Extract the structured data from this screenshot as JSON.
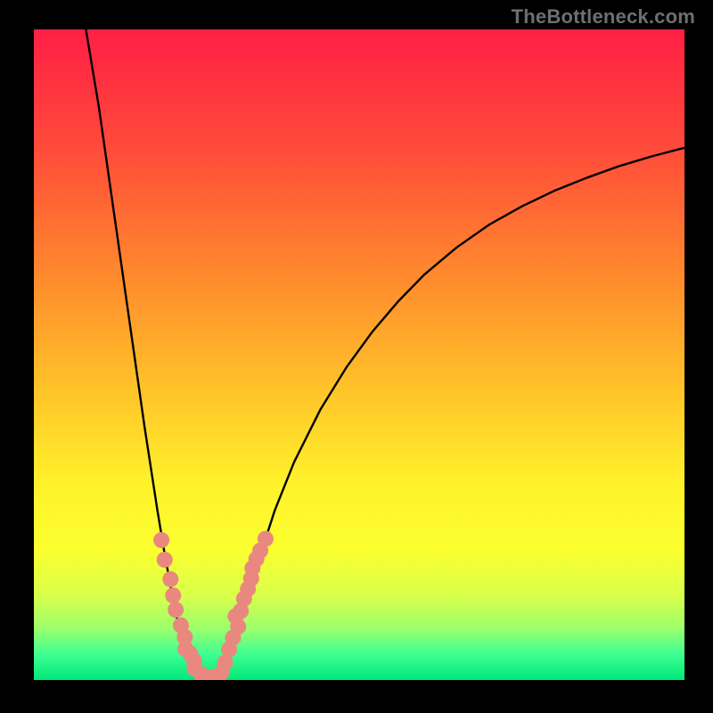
{
  "watermark": "TheBottleneck.com",
  "chart_data": {
    "type": "line",
    "title": "",
    "xlabel": "",
    "ylabel": "",
    "xlim": [
      0,
      100
    ],
    "ylim": [
      0,
      100
    ],
    "grid": false,
    "legend": false,
    "gradient_stops": [
      {
        "offset": 0.0,
        "color": "#ff1f45"
      },
      {
        "offset": 0.18,
        "color": "#ff4a3a"
      },
      {
        "offset": 0.38,
        "color": "#ff8a2d"
      },
      {
        "offset": 0.55,
        "color": "#ffc229"
      },
      {
        "offset": 0.7,
        "color": "#fff22a"
      },
      {
        "offset": 0.8,
        "color": "#fbff2f"
      },
      {
        "offset": 0.87,
        "color": "#d9ff4a"
      },
      {
        "offset": 0.92,
        "color": "#9dff6c"
      },
      {
        "offset": 0.96,
        "color": "#3fff92"
      },
      {
        "offset": 1.0,
        "color": "#00e87a"
      }
    ],
    "series": [
      {
        "name": "bottleneck-curve",
        "color": "#000000",
        "points": [
          {
            "x": 8.0,
            "y": 100.0
          },
          {
            "x": 9.0,
            "y": 94.0
          },
          {
            "x": 10.0,
            "y": 88.0
          },
          {
            "x": 11.0,
            "y": 81.0
          },
          {
            "x": 12.0,
            "y": 74.0
          },
          {
            "x": 13.0,
            "y": 67.0
          },
          {
            "x": 14.0,
            "y": 60.0
          },
          {
            "x": 15.0,
            "y": 53.0
          },
          {
            "x": 16.0,
            "y": 46.0
          },
          {
            "x": 17.0,
            "y": 39.0
          },
          {
            "x": 18.0,
            "y": 32.5
          },
          {
            "x": 19.0,
            "y": 26.0
          },
          {
            "x": 20.0,
            "y": 20.0
          },
          {
            "x": 21.0,
            "y": 14.5
          },
          {
            "x": 22.0,
            "y": 9.5
          },
          {
            "x": 23.0,
            "y": 5.5
          },
          {
            "x": 24.0,
            "y": 2.5
          },
          {
            "x": 25.0,
            "y": 0.8
          },
          {
            "x": 26.0,
            "y": 0.2
          },
          {
            "x": 27.0,
            "y": 0.2
          },
          {
            "x": 28.0,
            "y": 0.8
          },
          {
            "x": 29.0,
            "y": 2.2
          },
          {
            "x": 30.0,
            "y": 4.3
          },
          {
            "x": 31.0,
            "y": 7.0
          },
          {
            "x": 32.0,
            "y": 10.0
          },
          {
            "x": 33.0,
            "y": 13.2
          },
          {
            "x": 34.0,
            "y": 16.5
          },
          {
            "x": 35.0,
            "y": 19.8
          },
          {
            "x": 37.0,
            "y": 26.0
          },
          {
            "x": 40.0,
            "y": 33.5
          },
          {
            "x": 44.0,
            "y": 41.5
          },
          {
            "x": 48.0,
            "y": 48.0
          },
          {
            "x": 52.0,
            "y": 53.5
          },
          {
            "x": 56.0,
            "y": 58.2
          },
          {
            "x": 60.0,
            "y": 62.3
          },
          {
            "x": 65.0,
            "y": 66.5
          },
          {
            "x": 70.0,
            "y": 70.0
          },
          {
            "x": 75.0,
            "y": 72.8
          },
          {
            "x": 80.0,
            "y": 75.2
          },
          {
            "x": 85.0,
            "y": 77.2
          },
          {
            "x": 90.0,
            "y": 79.0
          },
          {
            "x": 95.0,
            "y": 80.5
          },
          {
            "x": 100.0,
            "y": 81.8
          }
        ]
      },
      {
        "name": "highlight-dots",
        "color": "#e9887f",
        "radius": 9,
        "type_hint": "scatter",
        "points": [
          {
            "x": 19.6,
            "y": 21.5
          },
          {
            "x": 20.1,
            "y": 18.5
          },
          {
            "x": 21.0,
            "y": 15.5
          },
          {
            "x": 21.4,
            "y": 13.0
          },
          {
            "x": 21.8,
            "y": 10.8
          },
          {
            "x": 22.6,
            "y": 8.4
          },
          {
            "x": 23.2,
            "y": 6.6
          },
          {
            "x": 23.3,
            "y": 4.8
          },
          {
            "x": 24.0,
            "y": 4.1
          },
          {
            "x": 24.6,
            "y": 3.0
          },
          {
            "x": 24.7,
            "y": 1.8
          },
          {
            "x": 25.7,
            "y": 0.9
          },
          {
            "x": 26.3,
            "y": 0.5
          },
          {
            "x": 26.9,
            "y": 0.4
          },
          {
            "x": 27.5,
            "y": 0.4
          },
          {
            "x": 28.1,
            "y": 0.6
          },
          {
            "x": 28.8,
            "y": 1.1
          },
          {
            "x": 29.4,
            "y": 2.7
          },
          {
            "x": 30.0,
            "y": 4.7
          },
          {
            "x": 30.6,
            "y": 6.5
          },
          {
            "x": 31.4,
            "y": 8.2
          },
          {
            "x": 31.0,
            "y": 9.8
          },
          {
            "x": 31.8,
            "y": 10.6
          },
          {
            "x": 32.3,
            "y": 12.5
          },
          {
            "x": 32.9,
            "y": 14.0
          },
          {
            "x": 33.4,
            "y": 15.6
          },
          {
            "x": 33.6,
            "y": 17.2
          },
          {
            "x": 34.2,
            "y": 18.6
          },
          {
            "x": 34.8,
            "y": 19.9
          },
          {
            "x": 35.6,
            "y": 21.7
          }
        ]
      }
    ]
  }
}
